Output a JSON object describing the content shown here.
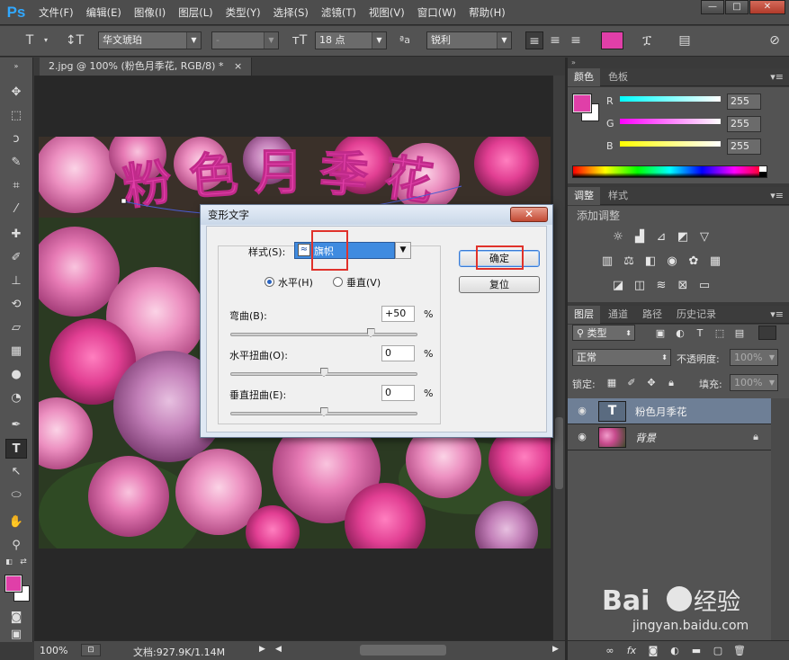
{
  "app": {
    "logo": "Ps"
  },
  "menu": [
    "文件(F)",
    "编辑(E)",
    "图像(I)",
    "图层(L)",
    "类型(Y)",
    "选择(S)",
    "滤镜(T)",
    "视图(V)",
    "窗口(W)",
    "帮助(H)"
  ],
  "window_controls": [
    "—",
    "□",
    "✕"
  ],
  "options": {
    "font_family": "华文琥珀",
    "font_style": "-",
    "font_size": "18 点",
    "aa_label": "ªa",
    "antialias": "锐利",
    "text_color": "#e03fa8"
  },
  "document": {
    "tab_title": "2.jpg @ 100% (粉色月季花, RGB/8) *",
    "canvas_text": "粉色月季花",
    "status_zoom": "100%",
    "status_doc": "文档:927.9K/1.14M"
  },
  "dialog": {
    "title": "变形文字",
    "close": "✕",
    "style_label": "样式(S):",
    "style_value": "旗帜",
    "horizontal": "水平(H)",
    "vertical": "垂直(V)",
    "bend_label": "弯曲(B):",
    "bend_value": "+50",
    "hdistort_label": "水平扭曲(O):",
    "hdistort_value": "0",
    "vdistort_label": "垂直扭曲(E):",
    "vdistort_value": "0",
    "percent": "%",
    "ok": "确定",
    "reset": "复位",
    "slider_levels": {
      "bend": 0.75,
      "hdistort": 0.5,
      "vdistort": 0.5
    }
  },
  "color_panel": {
    "tabs": [
      "颜色",
      "色板"
    ],
    "channels": [
      {
        "label": "R",
        "value": "255"
      },
      {
        "label": "G",
        "value": "255"
      },
      {
        "label": "B",
        "value": "255"
      }
    ]
  },
  "adjust_panel": {
    "tabs": [
      "调整",
      "样式"
    ],
    "heading": "添加调整"
  },
  "layers_panel": {
    "tabs": [
      "图层",
      "通道",
      "路径",
      "历史记录"
    ],
    "filter": "类型",
    "blend": "正常",
    "opacity_label": "不透明度:",
    "opacity": "100%",
    "lock_label": "锁定:",
    "fill_label": "填充:",
    "fill": "100%",
    "layers": [
      {
        "name": "粉色月季花",
        "type": "text"
      },
      {
        "name": "背景",
        "type": "image"
      }
    ]
  },
  "colors": {
    "foreground": "#e03fa8",
    "background": "#ffffff",
    "accent": "#e0322b"
  }
}
